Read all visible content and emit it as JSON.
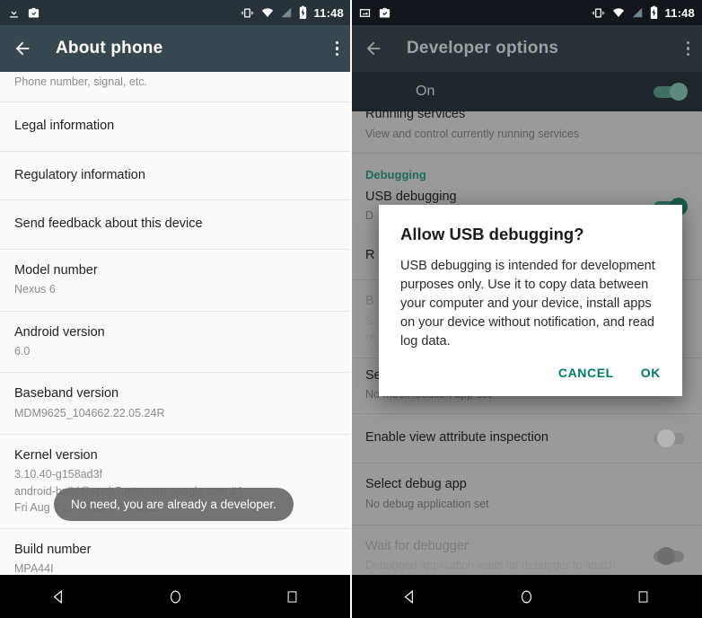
{
  "left_phone": {
    "statusbar": {
      "icons": [
        "download-icon",
        "work-briefcase-check-icon"
      ],
      "right_icons": [
        "vibrate-icon",
        "wifi-icon",
        "signal-off-icon",
        "battery-charging-icon"
      ],
      "time": "11:48"
    },
    "appbar": {
      "back": "back-arrow-icon",
      "title": "About phone",
      "overflow": "overflow-menu-icon"
    },
    "rows": [
      {
        "title": "",
        "subtitle": "Phone number, signal, etc.",
        "clipped": true
      },
      {
        "title": "Legal information",
        "subtitle": ""
      },
      {
        "title": "Regulatory information",
        "subtitle": ""
      },
      {
        "title": "Send feedback about this device",
        "subtitle": ""
      },
      {
        "title": "Model number",
        "subtitle": "Nexus 6"
      },
      {
        "title": "Android version",
        "subtitle": "6.0"
      },
      {
        "title": "Baseband version",
        "subtitle": "MDM9625_104662.22.05.24R"
      },
      {
        "title": "Kernel version",
        "subtitle": "3.10.40-g158ad3f\nandroid-build@vpeb5.mtv.corp.google.com #1\nFri Aug 7 17:58:13 UTC 2015"
      },
      {
        "title": "Build number",
        "subtitle": "MPA44I"
      }
    ],
    "toast": "No need, you are already a developer."
  },
  "right_phone": {
    "statusbar": {
      "icons": [
        "screenshot-image-icon",
        "work-briefcase-check-icon"
      ],
      "right_icons": [
        "vibrate-icon",
        "wifi-icon",
        "signal-off-icon",
        "battery-charging-icon"
      ],
      "time": "11:48"
    },
    "appbar": {
      "back": "back-arrow-icon",
      "title": "Developer options",
      "overflow": "overflow-menu-icon"
    },
    "master_switch": {
      "label": "On",
      "state": "on"
    },
    "rows": [
      {
        "title": "Running services",
        "subtitle": "View and control currently running services",
        "clipped": true,
        "kind": "item"
      },
      {
        "title": "Debugging",
        "subtitle": "",
        "kind": "section"
      },
      {
        "title": "USB debugging",
        "subtitle": "D",
        "kind": "toggle",
        "state": "on"
      },
      {
        "title": "R",
        "subtitle": "",
        "kind": "item"
      },
      {
        "title": "B",
        "subtitle": "S\nre",
        "kind": "item",
        "dim": true
      },
      {
        "title": "Select mock location app",
        "subtitle": "No mock location app set",
        "kind": "item"
      },
      {
        "title": "Enable view attribute inspection",
        "subtitle": "",
        "kind": "toggle",
        "state": "off"
      },
      {
        "title": "Select debug app",
        "subtitle": "No debug application set",
        "kind": "item"
      },
      {
        "title": "Wait for debugger",
        "subtitle": "Debugged application waits for debugger to attach",
        "kind": "toggle",
        "state": "off",
        "dim": true
      }
    ],
    "dialog": {
      "title": "Allow USB debugging?",
      "body": "USB debugging is intended for development purposes only. Use it to copy data between your computer and your device, install apps on your device without notification, and read log data.",
      "cancel_label": "CANCEL",
      "ok_label": "OK"
    }
  },
  "navbar": {
    "back": "nav-back-icon",
    "home": "nav-home-icon",
    "recents": "nav-recents-icon"
  },
  "colors": {
    "appbar": "#37474f",
    "statusbar": "#263238",
    "accent_teal": "#00796b",
    "section_teal": "#1f6b5a",
    "toast_bg": "#696969"
  }
}
